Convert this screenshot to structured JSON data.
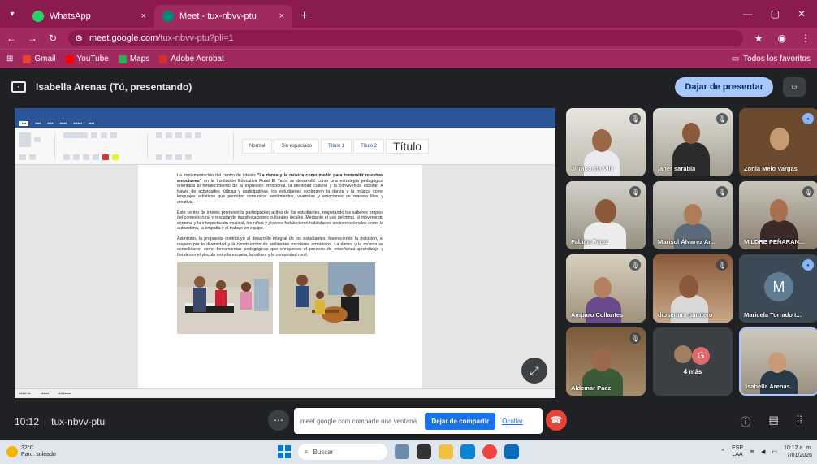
{
  "browser": {
    "tabs": [
      {
        "title": "WhatsApp",
        "close": "×",
        "favicon_color": "#25d366"
      },
      {
        "title": "Meet - tux-nbvv-ptu",
        "close": "×",
        "favicon_color": "#00897b"
      }
    ],
    "new_tab": "+",
    "url_host": "meet.google.com",
    "url_path": "/tux-nbvv-ptu?pli=1",
    "bookmarks": [
      {
        "label": "Gmail",
        "color": "#ea4335"
      },
      {
        "label": "YouTube",
        "color": "#ff0000"
      },
      {
        "label": "Maps",
        "color": "#34a853"
      },
      {
        "label": "Adobe Acrobat",
        "color": "#d32f2f"
      }
    ],
    "all_favorites": "Todos los favoritos"
  },
  "meet": {
    "presenter": "Isabella Arenas (Tú, presentando)",
    "stop_presenting": "Dajar de presentar",
    "time": "10:12",
    "separator": "|",
    "meeting_code": "tux-nbvv-ptu",
    "share_notice": "meet.google.com comparte una ventana.",
    "share_button": "Dejar de compartir",
    "hide_link": "Ocultar"
  },
  "document": {
    "styles": [
      "Normal",
      "Sin espaciado",
      "Título 1",
      "Título 2"
    ],
    "big_style": "Título",
    "p1_start": "La implementación del centro de interés ",
    "p1_bold": "\"La danza y la música como medio para transmitir nuestras emociones\"",
    "p1_end": " en la Institución Educativa Rural El Tarra se desarrolló como una estrategia pedagógica orientada al fortalecimiento de la expresión emocional, la identidad cultural y la convivencia escolar. A través de actividades lúdicas y participativas, los estudiantes exploraron la danza y la música como lenguajes artísticos que permiten comunicar sentimientos, vivencias y emociones de manera libre y creativa.",
    "p2": "Este centro de interés promovió la participación activa de los estudiantes, respetando los saberes propios del contexto rural y rescatando manifestaciones culturales locales. Mediante el uso del ritmo, el movimiento corporal y la interpretación musical, los niños y jóvenes fortalecieron habilidades socioemocionales como la autoestima, la empatía y el trabajo en equipo.",
    "p3": "Asimismo, la propuesta contribuyó al desarrollo integral de los estudiantes, favoreciendo la inclusión, el respeto por la diversidad y la construcción de ambientes escolares armónicos. La danza y la música se consolidaron como herramientas pedagógicas que enriquecen el proceso de enseñanza-aprendizaje y fortalecen el vínculo entre la escuela, la cultura y la comunidad rural."
  },
  "participants": [
    {
      "name": "Jl Taborda Vila"
    },
    {
      "name": "janer sarabia"
    },
    {
      "name": "Zonia Melo Vargas"
    },
    {
      "name": "Fabián Pérez"
    },
    {
      "name": "Marisol Álvarez Ar..."
    },
    {
      "name": "MILDRE PEÑARAN..."
    },
    {
      "name": "Amparo Collantes"
    },
    {
      "name": "diosemira quintero"
    },
    {
      "name": "Maricela Torrado t...",
      "initial": "M"
    },
    {
      "name": "Aldemar Paez"
    },
    {
      "name": "4 más",
      "initial": "G"
    },
    {
      "name": "Isabella Arenas"
    }
  ],
  "taskbar": {
    "temperature": "32°C",
    "weather": "Parc. soleado",
    "search": "Buscar",
    "lang1": "ESP",
    "lang2": "LAA",
    "time": "10:12 a. m.",
    "date": "7/01/2026"
  }
}
